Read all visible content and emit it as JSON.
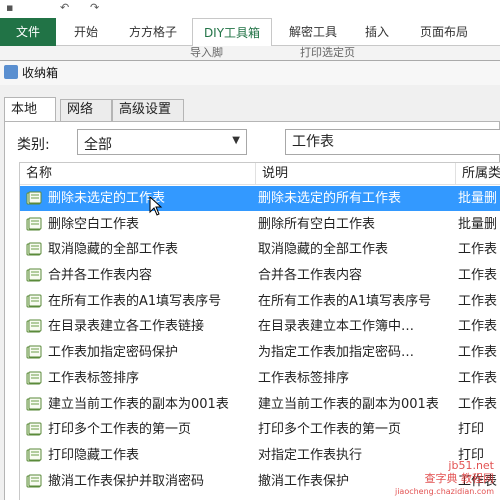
{
  "ribbon": {
    "tabs": [
      "文件",
      "开始",
      "方方格子",
      "DIY工具箱",
      "解密工具",
      "插入",
      "页面布局"
    ],
    "active_tab": "DIY工具箱"
  },
  "toolbar": {
    "items": [
      "导入脚",
      "打印选定页"
    ]
  },
  "dialog": {
    "title": "收纳箱",
    "tabs": [
      "本地",
      "网络",
      "高级设置"
    ],
    "active_tab": "本地",
    "category_label": "类别:",
    "category_value": "全部",
    "search_value": "工作表",
    "columns": [
      "名称",
      "说明",
      "所属类"
    ],
    "rows": [
      {
        "name": "删除未选定的工作表",
        "desc": "删除未选定的所有工作表",
        "type": "批量删",
        "selected": true
      },
      {
        "name": "删除空白工作表",
        "desc": "删除所有空白工作表",
        "type": "批量删",
        "selected": false
      },
      {
        "name": "取消隐藏的全部工作表",
        "desc": "取消隐藏的全部工作表",
        "type": "工作表",
        "selected": false
      },
      {
        "name": "合并各工作表内容",
        "desc": "合并各工作表内容",
        "type": "工作表",
        "selected": false
      },
      {
        "name": "在所有工作表的A1填写表序号",
        "desc": "在所有工作表的A1填写表序号",
        "type": "工作表",
        "selected": false
      },
      {
        "name": "在目录表建立各工作表链接",
        "desc": "在目录表建立本工作簿中…",
        "type": "工作表",
        "selected": false
      },
      {
        "name": "工作表加指定密码保护",
        "desc": "为指定工作表加指定密码…",
        "type": "工作表",
        "selected": false
      },
      {
        "name": "工作表标签排序",
        "desc": "工作表标签排序",
        "type": "工作表",
        "selected": false
      },
      {
        "name": "建立当前工作表的副本为001表",
        "desc": "建立当前工作表的副本为001表",
        "type": "工作表",
        "selected": false
      },
      {
        "name": "打印多个工作表的第一页",
        "desc": "打印多个工作表的第一页",
        "type": "打印",
        "selected": false
      },
      {
        "name": "打印隐藏工作表",
        "desc": "对指定工作表执行",
        "type": "打印",
        "selected": false
      },
      {
        "name": "撤消工作表保护并取消密码",
        "desc": "撤消工作表保护",
        "type": "工作表",
        "selected": false
      }
    ]
  },
  "watermark": {
    "line1": "jb51.net",
    "line2": "查字典 教程网",
    "line3": "jiaocheng.chazidian.com"
  },
  "colors": {
    "file_tab": "#217346",
    "selection": "#3399ff"
  }
}
